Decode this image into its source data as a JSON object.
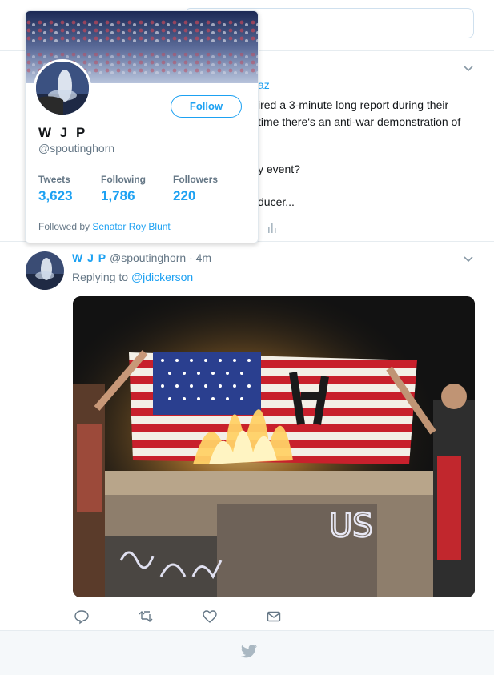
{
  "background_tweet": {
    "author_fragment": "az",
    "lines": [
      "ired a 3-minute long report during their",
      "time there's an anti-war demonstration of",
      "y event?",
      "ducer..."
    ]
  },
  "profile_card": {
    "name": "W J P",
    "handle": "@spoutinghorn",
    "follow_label": "Follow",
    "stats": [
      {
        "label": "Tweets",
        "value": "3,623"
      },
      {
        "label": "Following",
        "value": "1,786"
      },
      {
        "label": "Followers",
        "value": "220"
      }
    ],
    "followed_by_prefix": "Followed by",
    "followed_by_name": "Senator Roy Blunt"
  },
  "reply_tweet": {
    "name": "W J P",
    "handle": "@spoutinghorn",
    "separator": "·",
    "time": "4m",
    "replying_prefix": "Replying to",
    "replying_to": "@jdickerson",
    "graffiti_text": "US",
    "actions": [
      "reply-icon",
      "retweet-icon",
      "like-icon",
      "direct-message-icon"
    ]
  },
  "colors": {
    "accent": "#1da1f2",
    "secondary_text": "#657786",
    "border": "#e6ecf0"
  }
}
